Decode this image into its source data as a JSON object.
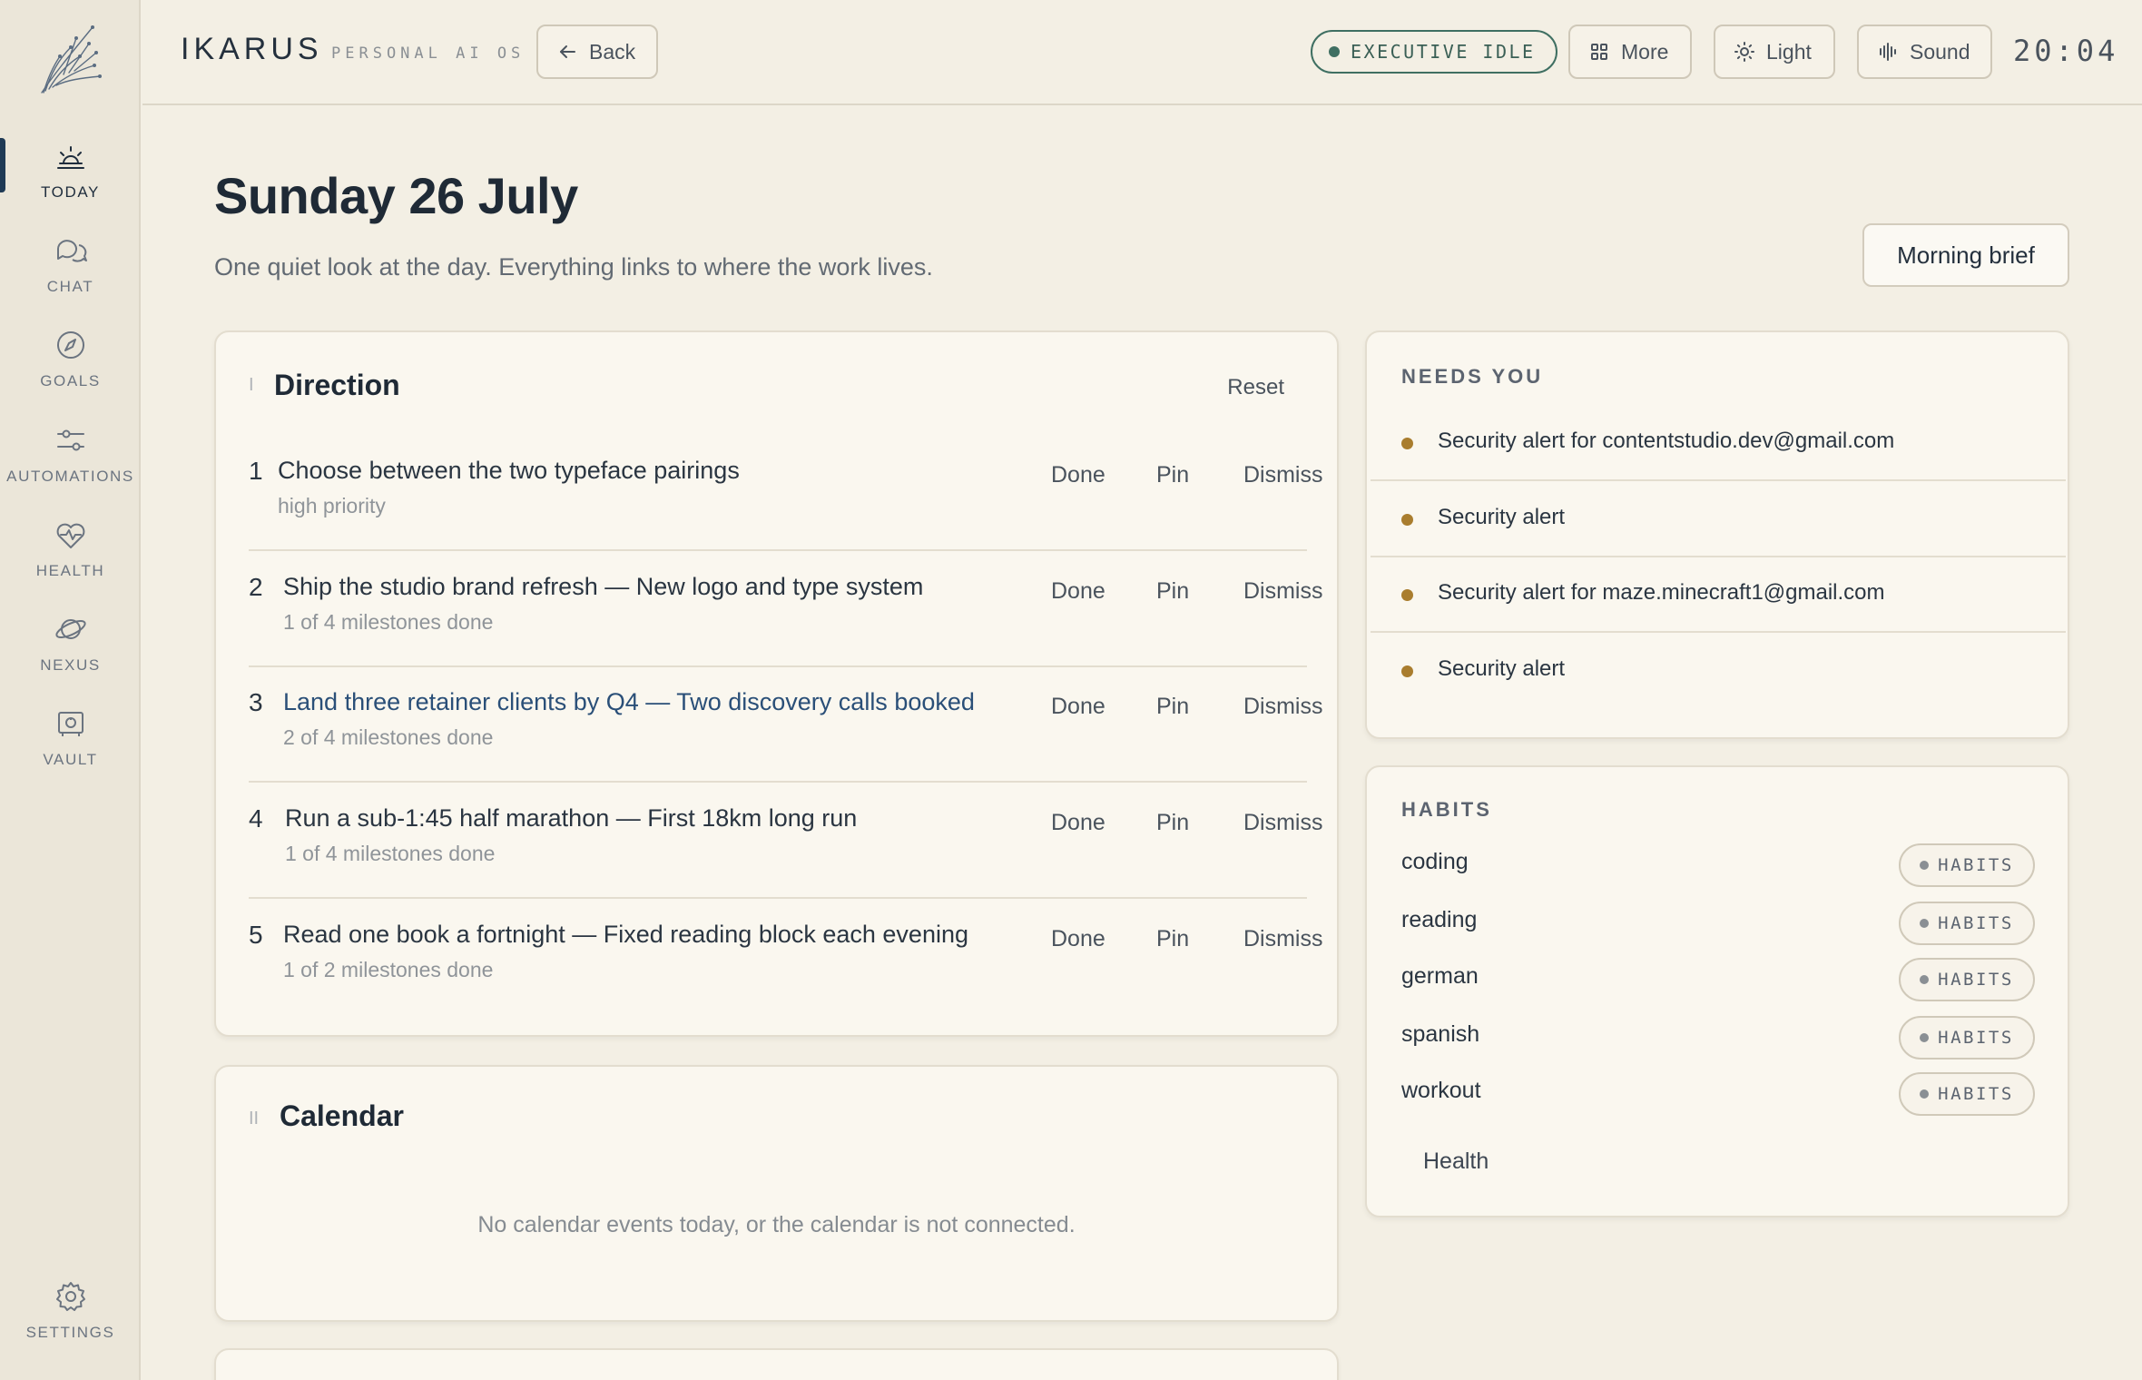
{
  "sidebar": {
    "items": [
      {
        "label": "TODAY",
        "icon": "sunrise-icon"
      },
      {
        "label": "CHAT",
        "icon": "chat-bubbles-icon"
      },
      {
        "label": "GOALS",
        "icon": "compass-icon"
      },
      {
        "label": "AUTOMATIONS",
        "icon": "sliders-icon"
      },
      {
        "label": "HEALTH",
        "icon": "heart-pulse-icon"
      },
      {
        "label": "NEXUS",
        "icon": "planet-icon"
      },
      {
        "label": "VAULT",
        "icon": "vault-icon"
      }
    ],
    "settings_label": "SETTINGS"
  },
  "header": {
    "brand": "IKARUS",
    "brand_sub": "PERSONAL AI OS",
    "back_label": "Back",
    "status_label": "EXECUTIVE IDLE",
    "more_label": "More",
    "theme_label": "Light",
    "sound_label": "Sound",
    "clock": "20:04"
  },
  "page": {
    "title": "Sunday 26 July",
    "subtitle": "One quiet look at the day. Everything links to where the work lives.",
    "morning_brief_label": "Morning brief"
  },
  "direction": {
    "title": "Direction",
    "reset_label": "Reset",
    "actions": {
      "done": "Done",
      "pin": "Pin",
      "dismiss": "Dismiss"
    },
    "items": [
      {
        "num": "1",
        "text": "Choose between the two typeface pairings",
        "meta": "high priority"
      },
      {
        "num": "2",
        "text": "Ship the studio brand refresh — New logo and type system",
        "meta": "1 of 4 milestones done"
      },
      {
        "num": "3",
        "text": "Land three retainer clients by Q4 — Two discovery calls booked",
        "meta": "2 of 4 milestones done"
      },
      {
        "num": "4",
        "text": "Run a sub-1:45 half marathon — First 18km long run",
        "meta": "1 of 4 milestones done"
      },
      {
        "num": "5",
        "text": "Read one book a fortnight — Fixed reading block each evening",
        "meta": "1 of 2 milestones done"
      }
    ]
  },
  "calendar": {
    "title": "Calendar",
    "empty_text": "No calendar events today, or the calendar is not connected."
  },
  "needs_you": {
    "title": "NEEDS YOU",
    "accent_color": "#a97d2e",
    "items": [
      "Security alert for contentstudio.dev@gmail.com",
      "Security alert",
      "Security alert for maze.minecraft1@gmail.com",
      "Security alert"
    ]
  },
  "habits": {
    "title": "HABITS",
    "tag_label": "HABITS",
    "items": [
      "coding",
      "reading",
      "german",
      "spanish",
      "workout"
    ],
    "health_link": "Health"
  },
  "colors": {
    "background": "#f3efe4",
    "card": "#faf7ef",
    "status_green": "#3f6f62",
    "link_blue": "#2a4f78"
  }
}
